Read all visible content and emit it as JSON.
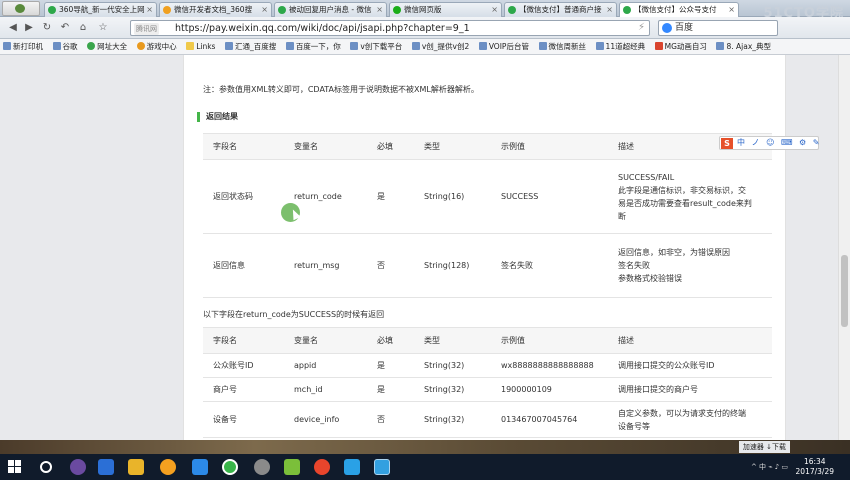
{
  "tabs": [
    {
      "label": "360导航_新一代安全上网",
      "icon": "green"
    },
    {
      "label": "微信开发者文档_360搜",
      "icon": "orange"
    },
    {
      "label": "被动回复用户消息 - 微信",
      "icon": "green"
    },
    {
      "label": "微信网页版",
      "icon": "wx"
    },
    {
      "label": "【微信支付】普通商户接",
      "icon": "green"
    },
    {
      "label": "【微信支付】公众号支付",
      "icon": "green"
    }
  ],
  "watermark": "51CTO学院",
  "address": {
    "site_badge": "腾讯网",
    "url": "https://pay.weixin.qq.com/wiki/doc/api/jsapi.php?chapter=9_1"
  },
  "search_engine": "百度",
  "bookmarks": [
    {
      "label": "新打印机",
      "icon": "blue"
    },
    {
      "label": "谷歌",
      "icon": "blue"
    },
    {
      "label": "网址大全",
      "icon": "green"
    },
    {
      "label": "游戏中心",
      "icon": "orange"
    },
    {
      "label": "Links",
      "icon": "folder"
    },
    {
      "label": "汇通_百度搜",
      "icon": "blue"
    },
    {
      "label": "百度一下，你",
      "icon": "blue"
    },
    {
      "label": "v创下载平台",
      "icon": "blue"
    },
    {
      "label": "v创_提供v创2",
      "icon": "blue"
    },
    {
      "label": "VOIP后台管",
      "icon": "blue"
    },
    {
      "label": "微信周新丝",
      "icon": "blue"
    },
    {
      "label": "11道超经典",
      "icon": "blue"
    },
    {
      "label": "MG动画自习",
      "icon": "red"
    },
    {
      "label": "8. Ajax_典型",
      "icon": "blue"
    }
  ],
  "page": {
    "note": "注：参数值用XML转义即可，CDATA标签用于说明数据不被XML解析器解析。",
    "section_title": "返回结果",
    "headers": [
      "字段名",
      "变量名",
      "必填",
      "类型",
      "示例值",
      "描述"
    ],
    "table1": [
      {
        "name": "返回状态码",
        "var": "return_code",
        "required": "是",
        "type": "String(16)",
        "example": "SUCCESS",
        "desc": [
          "SUCCESS/FAIL",
          "此字段是通信标识，非交易标识，交",
          "易是否成功需要查看result_code来判",
          "断"
        ]
      },
      {
        "name": "返回信息",
        "var": "return_msg",
        "required": "否",
        "type": "String(128)",
        "example": "签名失败",
        "desc": [
          "返回信息，如非空，为错误原因",
          "签名失败",
          "参数格式校验错误"
        ]
      }
    ],
    "subnote": "以下字段在return_code为SUCCESS的时候有返回",
    "table2": [
      {
        "name": "公众账号ID",
        "var": "appid",
        "required": "是",
        "type": "String(32)",
        "example": "wx8888888888888888",
        "desc": [
          "调用接口提交的公众账号ID"
        ]
      },
      {
        "name": "商户号",
        "var": "mch_id",
        "required": "是",
        "type": "String(32)",
        "example": "1900000109",
        "desc": [
          "调用接口提交的商户号"
        ]
      },
      {
        "name": "设备号",
        "var": "device_info",
        "required": "否",
        "type": "String(32)",
        "example": "013467007045764",
        "desc": [
          "自定义参数，可以为请求支付的终端",
          "设备号等"
        ]
      }
    ]
  },
  "float_toolbar": {
    "logo": "S",
    "items": "中 ノ ☺ ⌨ ⚙ ✎"
  },
  "status_bar": "加速器  ↓下载",
  "clock": {
    "time": "16:34",
    "date": "2017/3/29"
  },
  "tray": "^ 中 ⌁ ♪ ▭"
}
